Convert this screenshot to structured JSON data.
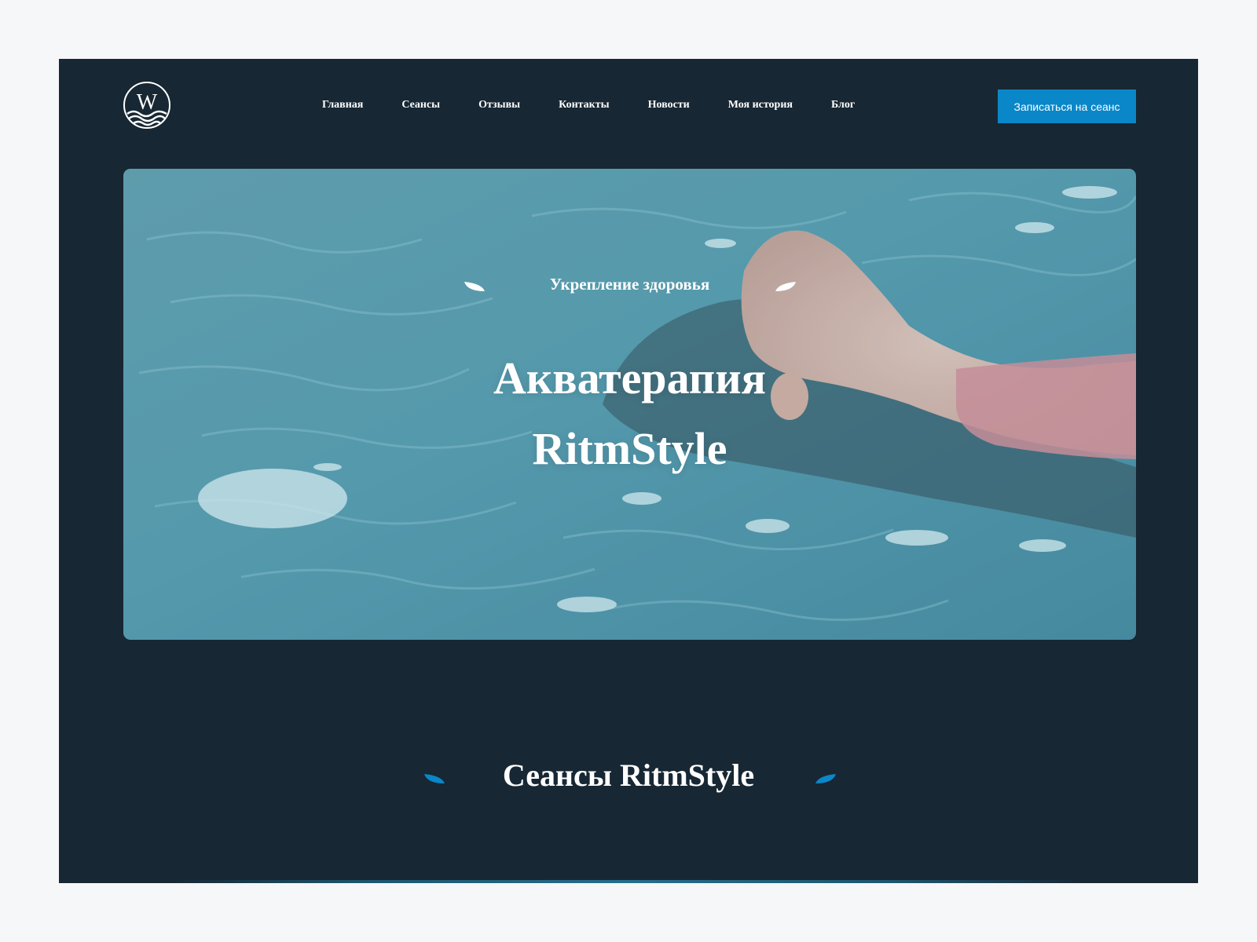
{
  "logo": {
    "letter": "W",
    "icon": "waves-logo-icon"
  },
  "nav": {
    "items": [
      {
        "label": "Главная"
      },
      {
        "label": "Сеансы"
      },
      {
        "label": "Отзывы"
      },
      {
        "label": "Контакты"
      },
      {
        "label": "Новости"
      },
      {
        "label": "Моя история"
      },
      {
        "label": "Блог"
      }
    ]
  },
  "cta": {
    "label": "Записаться на сеанс"
  },
  "hero": {
    "subtitle": "Укрепление здоровья",
    "title_line1": "Акватерапия",
    "title_line2": "RitmStyle",
    "leaf_icon": "leaf-icon"
  },
  "sessions": {
    "title": "Сеансы RitmStyle",
    "leaf_icon": "leaf-icon"
  },
  "colors": {
    "background": "#172733",
    "page": "#f6f7f9",
    "accent": "#0a87c8",
    "text": "#ffffff"
  }
}
